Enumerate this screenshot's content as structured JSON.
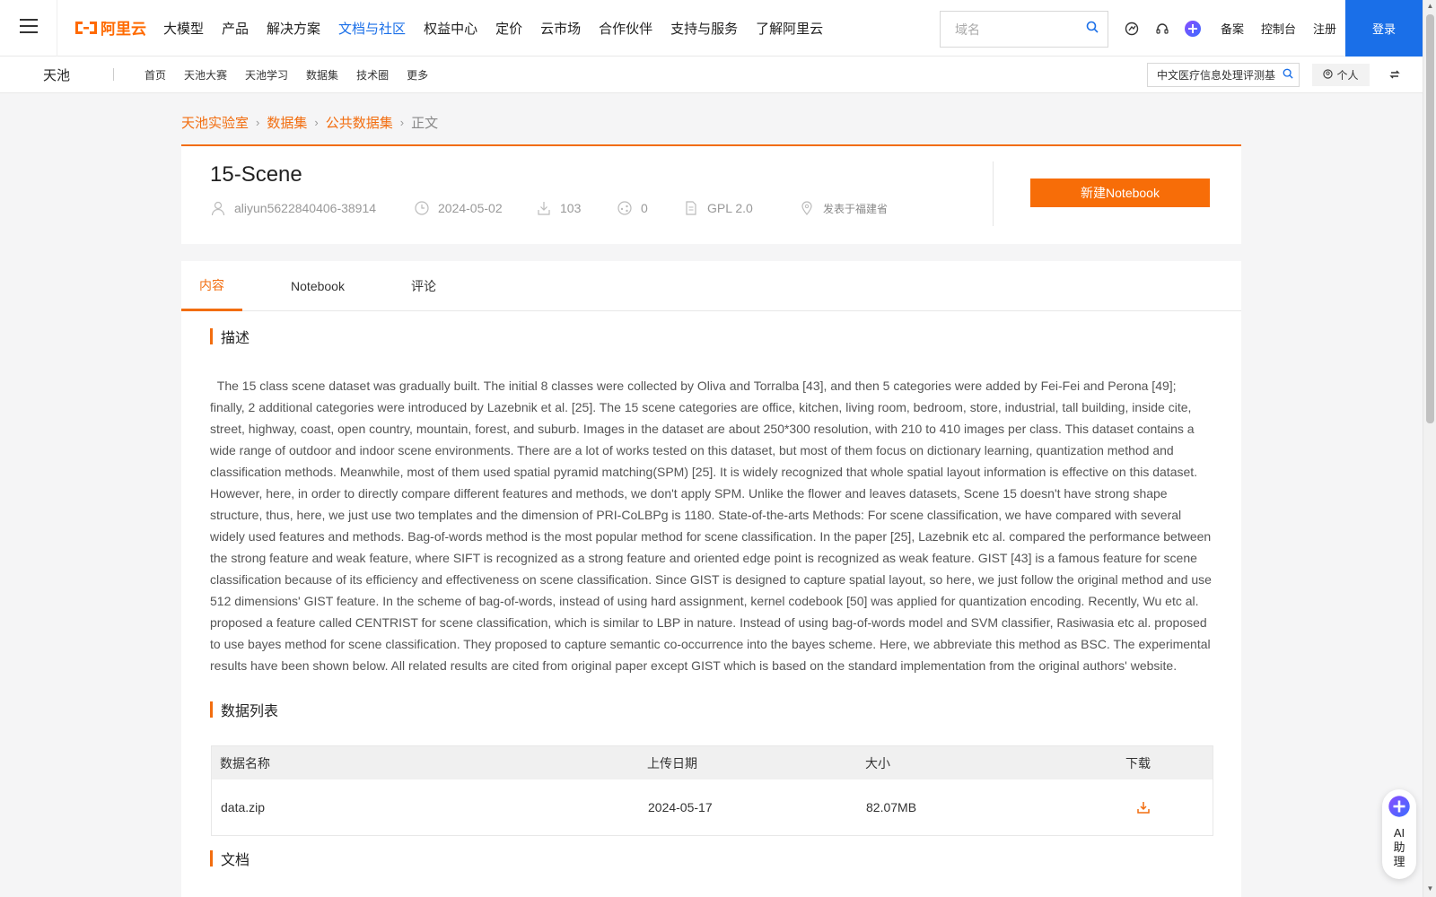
{
  "topnav": {
    "items": [
      "大模型",
      "产品",
      "解决方案",
      "文档与社区",
      "权益中心",
      "定价",
      "云市场",
      "合作伙伴",
      "支持与服务",
      "了解阿里云"
    ],
    "active_index": 3,
    "search_placeholder": "域名",
    "right_links": [
      "备案",
      "控制台",
      "注册"
    ],
    "login_label": "登录",
    "brand_color": "#ff6a00",
    "accent_color": "#1a6fe8"
  },
  "subnav": {
    "brand": "天池",
    "items": [
      "首页",
      "天池大赛",
      "天池学习",
      "数据集",
      "技术圈",
      "更多"
    ],
    "search_value": "中文医疗信息处理评测基",
    "personal_label": "个人"
  },
  "breadcrumb": [
    "天池实验室",
    "数据集",
    "公共数据集",
    "正文"
  ],
  "dataset": {
    "title": "15-Scene",
    "author": "aliyun5622840406-38914",
    "date": "2024-05-02",
    "downloads": "103",
    "shares": "0",
    "license": "GPL 2.0",
    "location": "发表于福建省",
    "new_notebook_label": "新建Notebook"
  },
  "tabs": [
    "内容",
    "Notebook",
    "评论"
  ],
  "sections": {
    "description_heading": "描述",
    "description": "The 15 class scene dataset was gradually built. The initial 8 classes were collected by Oliva and Torralba [43], and then 5 categories were added by Fei-Fei and Perona [49]; finally, 2 additional categories were introduced by Lazebnik et al. [25]. The 15 scene categories are office, kitchen, living room, bedroom, store, industrial, tall building, inside cite, street, highway, coast, open country, mountain, forest, and suburb. Images in the dataset are about 250*300 resolution, with 210 to 410 images per class. This dataset contains a wide range of outdoor and indoor scene environments. There are a lot of works tested on this dataset, but most of them focus on dictionary learning, quantization method and classification methods. Meanwhile, most of them used spatial pyramid matching(SPM) [25]. It is widely recognized that whole spatial layout information is effective on this dataset. However, here, in order to directly compare different features and methods, we don't apply SPM. Unlike the flower and leaves datasets, Scene 15 doesn't have strong shape structure, thus, here, we just use two templates and the dimension of PRI-CoLBPg is 1180. State-of-the-arts Methods: For scene classification, we have compared with several widely used features and methods. Bag-of-words method is the most popular method for scene classification. In the paper [25], Lazebnik etc al. compared the performance between the strong feature and weak feature, where SIFT is recognized as a strong feature and oriented edge point is recognized as weak feature. GIST [43] is a famous feature for scene classification because of its efficiency and effectiveness on scene classification. Since GIST is designed to capture spatial layout, so here, we just follow the original method and use 512 dimensions' GIST feature. In the scheme of bag-of-words, instead of using hard assignment, kernel codebook [50] was applied for quantization encoding. Recently, Wu etc al. proposed a feature called CENTRIST for scene classification, which is similar to LBP in nature. Instead of using bag-of-words model and SVM classifier, Rasiwasia etc al. proposed to use bayes method for scene classification. They proposed to capture semantic co-occurrence into the bayes scheme. Here, we abbreviate this method as BSC. The experimental results have been shown below. All related results are cited from original paper except GIST which is based on the standard implementation from the original authors' website.",
    "datalist_heading": "数据列表",
    "docs_heading": "文档"
  },
  "table": {
    "headers": [
      "数据名称",
      "上传日期",
      "大小",
      "下载"
    ],
    "rows": [
      {
        "name": "data.zip",
        "date": "2024-05-17",
        "size": "82.07MB",
        "icon": "download-icon"
      }
    ]
  },
  "ai_assistant": {
    "label": "AI助理"
  }
}
